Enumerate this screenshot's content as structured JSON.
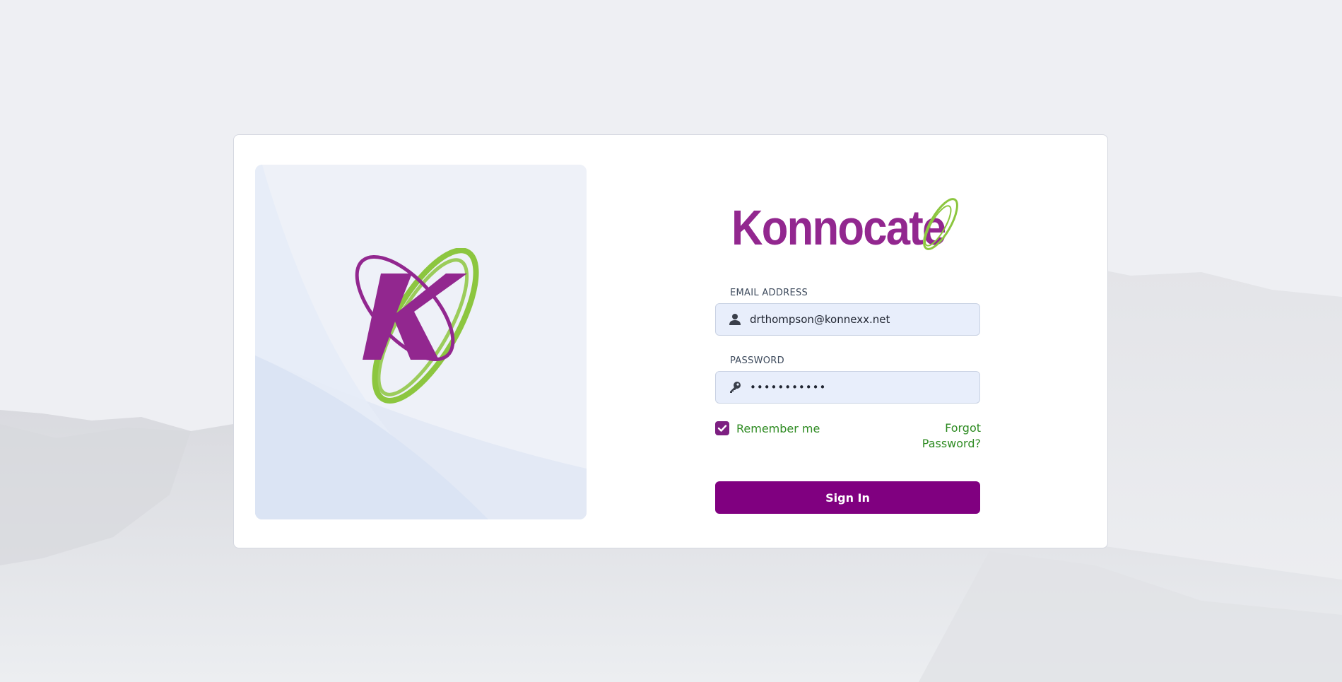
{
  "brand": {
    "name": "Konnocate",
    "primary_color": "#800080",
    "logo_purple": "#92278f",
    "accent_green": "#8cc63f"
  },
  "hero": {
    "logo_icon": "konnocate-k-orbit-logo"
  },
  "form": {
    "email": {
      "label": "EMAIL ADDRESS",
      "value": "drthompson@konnexx.net",
      "icon": "user-icon"
    },
    "password": {
      "label": "PASSWORD",
      "value": "•••••••••••",
      "icon": "key-icon"
    },
    "remember": {
      "label": "Remember me",
      "checked": true
    },
    "forgot_label": "Forgot Password?",
    "submit_label": "Sign In"
  },
  "colors": {
    "link_green": "#2e8b22",
    "field_bg": "#e8eefb"
  }
}
